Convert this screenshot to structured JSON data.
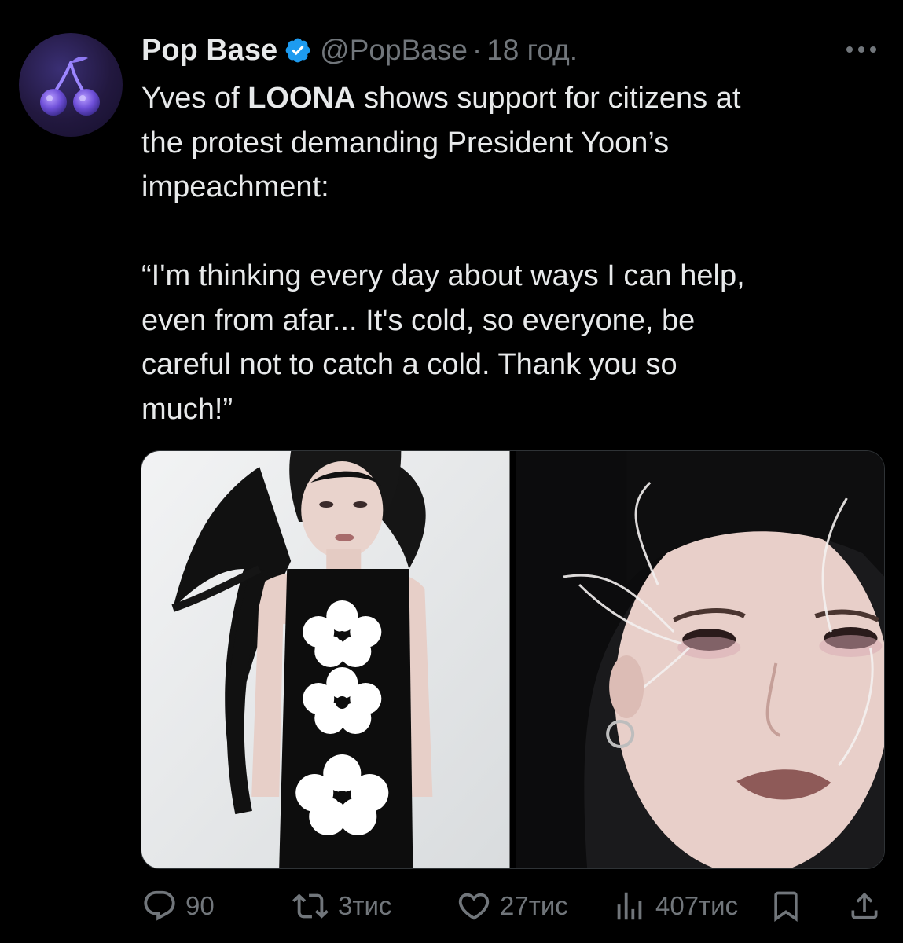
{
  "tweet": {
    "display_name": "Pop Base",
    "handle": "@PopBase",
    "separator": "·",
    "time": "18 год.",
    "text_line1_prefix": "Yves of ",
    "text_line1_bold": "LOONA",
    "text_line1_suffix": " shows support for citizens at",
    "text_line2": "the protest demanding President Yoon’s",
    "text_line3": "impeachment:",
    "quote_line1": "“I'm thinking every day about ways I can help,",
    "quote_line2": "even from afar... It's cold, so everyone, be",
    "quote_line3": "careful not to catch a cold. Thank you so",
    "quote_line4": "much!”"
  },
  "actions": {
    "replies": "90",
    "reposts": "3тис",
    "likes": "27тис",
    "views": "407тис"
  },
  "icons": {
    "avatar": "cherry-logo-icon",
    "verified": "verified-badge-icon",
    "more": "more-options-icon",
    "reply": "reply-icon",
    "repost": "repost-icon",
    "like": "heart-icon",
    "views": "views-chart-icon",
    "bookmark": "bookmark-icon",
    "share": "share-icon"
  },
  "colors": {
    "background": "#000000",
    "text": "#e7e9ea",
    "secondary": "#71767b",
    "verified": "#1d9bf0"
  }
}
